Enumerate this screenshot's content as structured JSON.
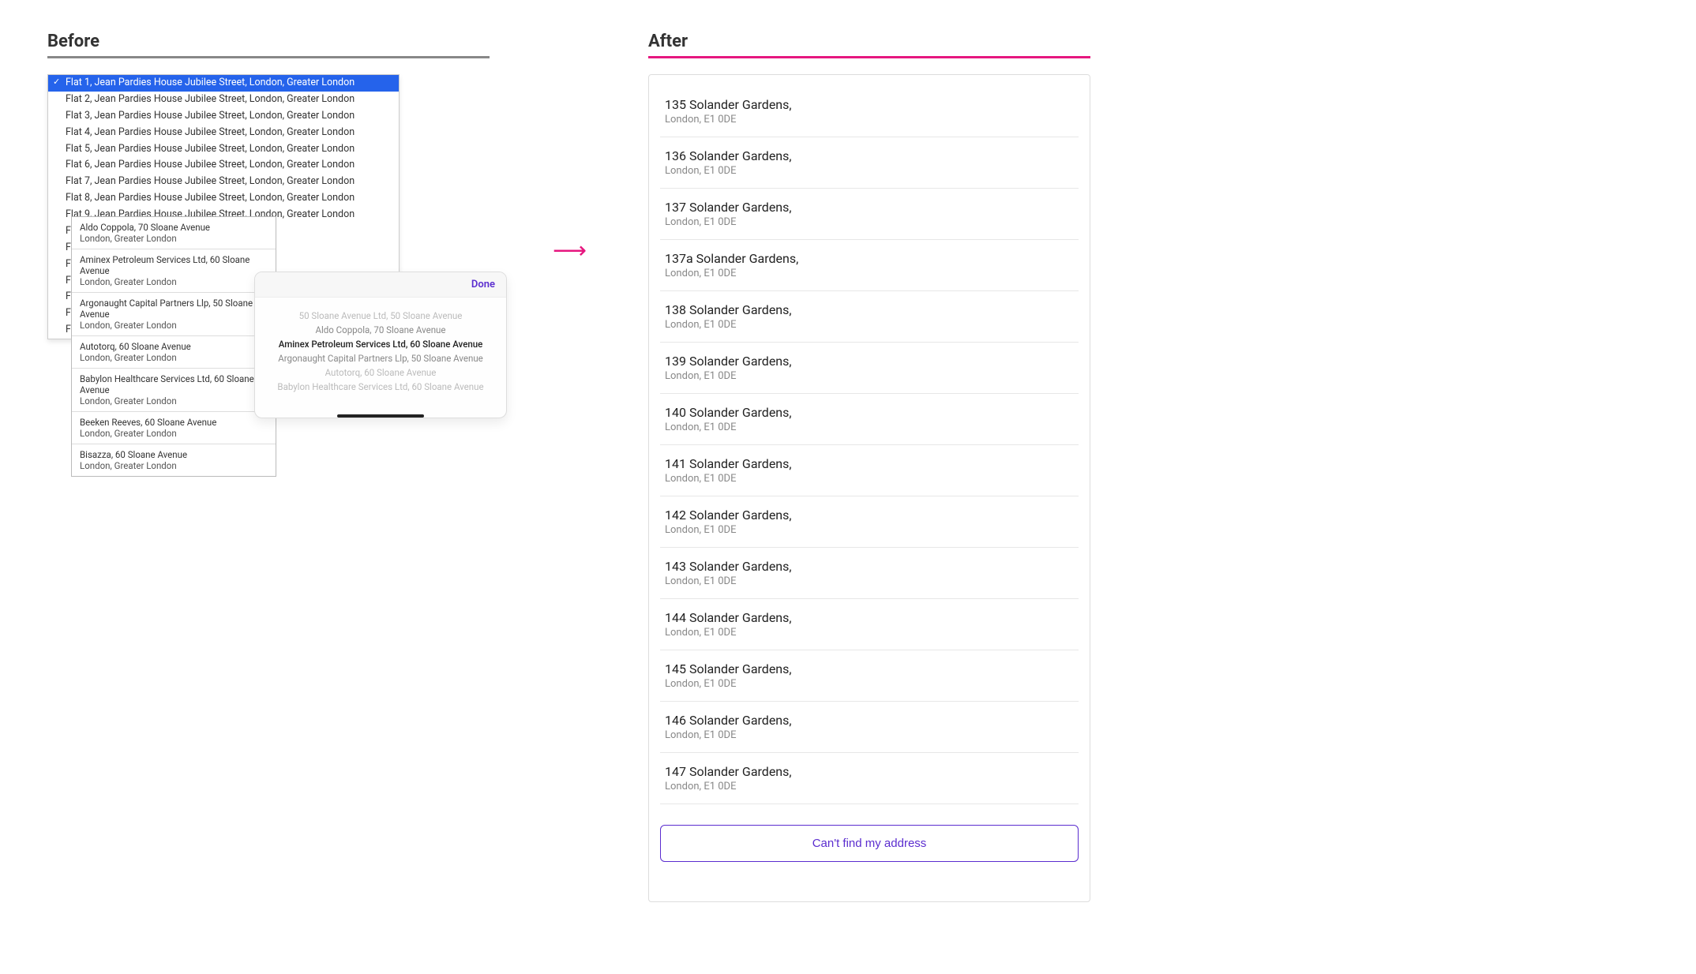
{
  "headings": {
    "before": "Before",
    "after": "After"
  },
  "before": {
    "dropdown_options": [
      "Flat 1, Jean Pardies House Jubilee Street, London, Greater London",
      "Flat 2, Jean Pardies House Jubilee Street, London, Greater London",
      "Flat 3, Jean Pardies House Jubilee Street, London, Greater London",
      "Flat 4, Jean Pardies House Jubilee Street, London, Greater London",
      "Flat 5, Jean Pardies House Jubilee Street, London, Greater London",
      "Flat 6, Jean Pardies House Jubilee Street, London, Greater London",
      "Flat 7, Jean Pardies House Jubilee Street, London, Greater London",
      "Flat 8, Jean Pardies House Jubilee Street, London, Greater London",
      "Flat 9, Jean Pardies House Jubilee Street, London, Greater London",
      "Fl                                                                                 ondon, Greater London",
      "Fl                                                                                 ondon, Greater London",
      "Fl                                                                                 ondon, Greater London",
      "Fl                                                                                 ondon, Greater London",
      "Fl",
      "Fl",
      "Fl"
    ],
    "popup_entries": [
      {
        "l1": "Aldo Coppola, 70 Sloane Avenue",
        "l2": "London, Greater London"
      },
      {
        "l1": "Aminex Petroleum Services Ltd, 60 Sloane Avenue",
        "l2": "London, Greater London"
      },
      {
        "l1": "Argonaught Capital Partners Llp, 50 Sloane Avenue",
        "l2": "London, Greater London"
      },
      {
        "l1": "Autotorq, 60 Sloane Avenue",
        "l2": "London, Greater London"
      },
      {
        "l1": "Babylon Healthcare Services Ltd, 60 Sloane Avenue",
        "l2": "London, Greater London"
      },
      {
        "l1": "Beeken Reeves, 60 Sloane Avenue",
        "l2": "London, Greater London"
      },
      {
        "l1": "Bisazza, 60 Sloane Avenue",
        "l2": "London, Greater London"
      }
    ],
    "picker": {
      "done": "Done",
      "rows": [
        "50 Sloane Avenue Ltd, 50 Sloane Avenue",
        "Aldo Coppola, 70 Sloane Avenue",
        "Aminex Petroleum Services Ltd, 60 Sloane Avenue",
        "Argonaught Capital Partners Llp, 50 Sloane Avenue",
        "Autotorq, 60 Sloane Avenue",
        "Babylon Healthcare Services Ltd, 60 Sloane Avenue"
      ],
      "focus_index": 2
    }
  },
  "after": {
    "addresses": [
      {
        "l1": "135 Solander Gardens,",
        "l2": "London, E1 0DE"
      },
      {
        "l1": "136 Solander Gardens,",
        "l2": "London, E1 0DE"
      },
      {
        "l1": "137 Solander Gardens,",
        "l2": "London, E1 0DE"
      },
      {
        "l1": "137a Solander Gardens,",
        "l2": "London, E1 0DE"
      },
      {
        "l1": "138 Solander Gardens,",
        "l2": "London, E1 0DE"
      },
      {
        "l1": "139 Solander Gardens,",
        "l2": "London, E1 0DE"
      },
      {
        "l1": "140 Solander Gardens,",
        "l2": "London, E1 0DE"
      },
      {
        "l1": "141 Solander Gardens,",
        "l2": "London, E1 0DE"
      },
      {
        "l1": "142 Solander Gardens,",
        "l2": "London, E1 0DE"
      },
      {
        "l1": "143 Solander Gardens,",
        "l2": "London, E1 0DE"
      },
      {
        "l1": "144 Solander Gardens,",
        "l2": "London, E1 0DE"
      },
      {
        "l1": "145 Solander Gardens,",
        "l2": "London, E1 0DE"
      },
      {
        "l1": "146 Solander Gardens,",
        "l2": "London, E1 0DE"
      },
      {
        "l1": "147 Solander Gardens,",
        "l2": "London, E1 0DE"
      }
    ],
    "cta": "Can't find my address"
  }
}
